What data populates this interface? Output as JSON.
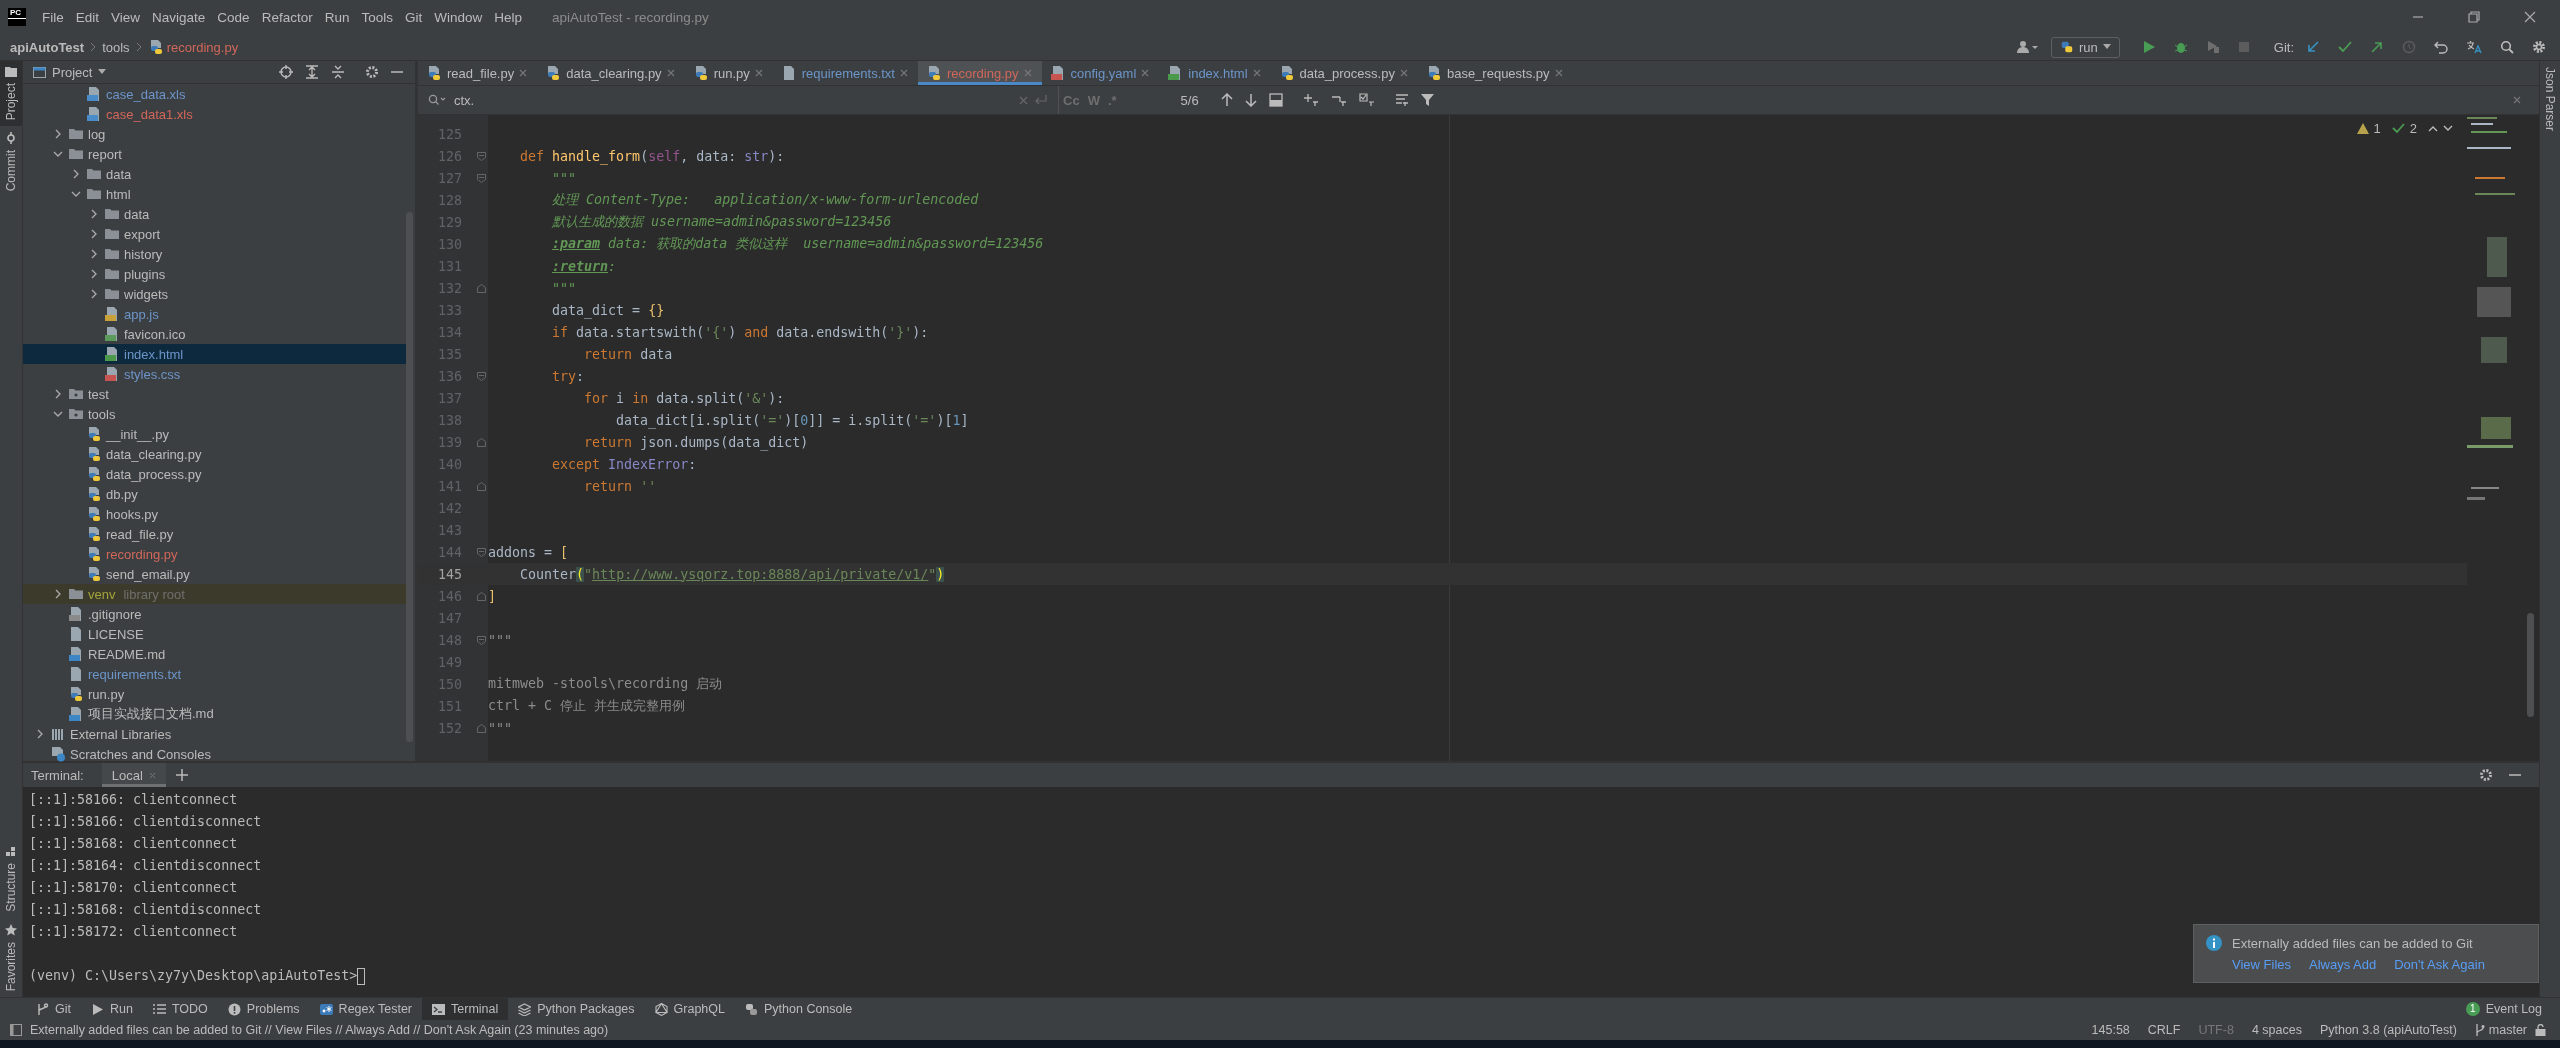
{
  "window": {
    "title": "apiAutoTest - recording.py",
    "logo": "PC"
  },
  "menu": [
    "File",
    "Edit",
    "View",
    "Navigate",
    "Code",
    "Refactor",
    "Run",
    "Tools",
    "Git",
    "Window",
    "Help"
  ],
  "breadcrumb": [
    {
      "label": "apiAutoTest",
      "kind": "project",
      "color": "#bbbbbb"
    },
    {
      "label": "tools",
      "kind": "folder",
      "color": "#bbbbbb"
    },
    {
      "label": "recording.py",
      "kind": "py",
      "color": "#d1675a"
    }
  ],
  "run_toolbar": {
    "configuration": "run",
    "git_label": "Git:"
  },
  "left_strip": {
    "top": [
      {
        "label": "Project",
        "selected": true,
        "kind": "project"
      },
      {
        "label": "Commit",
        "selected": false,
        "kind": "commit"
      }
    ],
    "bottom": [
      {
        "label": "Structure",
        "kind": "structure"
      },
      {
        "label": "Favorites",
        "kind": "favorites"
      }
    ]
  },
  "right_strip": {
    "label": "Json Parser"
  },
  "project_panel": {
    "title": "Project",
    "tree": [
      {
        "children": [
          {
            "children": [
              {
                "label": "case_data.xls",
                "kind": "xls",
                "color": "#6c95c9",
                "selected": false
              },
              {
                "label": "case_data1.xls",
                "kind": "xls",
                "color": "#d1675a",
                "selected": false
              }
            ]
          },
          {
            "label": "log",
            "kind": "folder",
            "expanded": false,
            "color": "#bbbbbb",
            "selected": false
          },
          {
            "label": "report",
            "kind": "folder",
            "expanded": true,
            "color": "#bbbbbb",
            "selected": false,
            "children": [
              {
                "label": "data",
                "kind": "folder",
                "expanded": false,
                "color": "#bbbbbb",
                "selected": false
              },
              {
                "label": "html",
                "kind": "folder",
                "expanded": true,
                "color": "#bbbbbb",
                "selected": false,
                "children": [
                  {
                    "label": "data",
                    "kind": "folder",
                    "expanded": false,
                    "color": "#bbbbbb",
                    "selected": false
                  },
                  {
                    "label": "export",
                    "kind": "folder",
                    "expanded": false,
                    "color": "#bbbbbb",
                    "selected": false
                  },
                  {
                    "label": "history",
                    "kind": "folder",
                    "expanded": false,
                    "color": "#bbbbbb",
                    "selected": false
                  },
                  {
                    "label": "plugins",
                    "kind": "folder",
                    "expanded": false,
                    "color": "#bbbbbb",
                    "selected": false
                  },
                  {
                    "label": "widgets",
                    "kind": "folder",
                    "expanded": false,
                    "color": "#bbbbbb",
                    "selected": false
                  },
                  {
                    "label": "app.js",
                    "kind": "js",
                    "color": "#6c95c9",
                    "selected": false
                  },
                  {
                    "label": "favicon.ico",
                    "kind": "ico",
                    "color": "#bbbbbb",
                    "selected": false
                  },
                  {
                    "label": "index.html",
                    "kind": "html",
                    "color": "#6c95c9",
                    "selected": true
                  },
                  {
                    "label": "styles.css",
                    "kind": "css",
                    "color": "#6c95c9",
                    "selected": false
                  }
                ]
              }
            ]
          },
          {
            "label": "test",
            "kind": "package",
            "expanded": false,
            "color": "#bbbbbb",
            "selected": false
          },
          {
            "label": "tools",
            "kind": "package",
            "expanded": true,
            "color": "#bbbbbb",
            "selected": false,
            "children": [
              {
                "label": "__init__.py",
                "kind": "py",
                "color": "#bbbbbb",
                "selected": false
              },
              {
                "label": "data_clearing.py",
                "kind": "py",
                "color": "#bbbbbb",
                "selected": false
              },
              {
                "label": "data_process.py",
                "kind": "py",
                "color": "#bbbbbb",
                "selected": false
              },
              {
                "label": "db.py",
                "kind": "py",
                "color": "#bbbbbb",
                "selected": false
              },
              {
                "label": "hooks.py",
                "kind": "py",
                "color": "#bbbbbb",
                "selected": false
              },
              {
                "label": "read_file.py",
                "kind": "py",
                "color": "#bbbbbb",
                "selected": false
              },
              {
                "label": "recording.py",
                "kind": "py",
                "color": "#d1675a",
                "selected": false
              },
              {
                "label": "send_email.py",
                "kind": "py",
                "color": "#bbbbbb",
                "selected": false
              }
            ]
          },
          {
            "label": "venv",
            "kind": "folder",
            "expanded": false,
            "color": "#a3a33b",
            "note": "library root",
            "selected": false
          },
          {
            "label": ".gitignore",
            "kind": "ignore",
            "color": "#bbbbbb",
            "selected": false
          },
          {
            "label": "LICENSE",
            "kind": "text",
            "color": "#bbbbbb",
            "selected": false
          },
          {
            "label": "README.md",
            "kind": "md",
            "color": "#bbbbbb",
            "selected": false
          },
          {
            "label": "requirements.txt",
            "kind": "text",
            "color": "#6c95c9",
            "selected": false
          },
          {
            "label": "run.py",
            "kind": "py",
            "color": "#bbbbbb",
            "selected": false
          },
          {
            "label": "项目实战接口文档.md",
            "kind": "md",
            "color": "#bbbbbb",
            "selected": false
          }
        ]
      },
      {
        "label": "External Libraries",
        "kind": "libraries",
        "expanded": false,
        "color": "#bbbbbb",
        "selected": false
      },
      {
        "label": "Scratches and Consoles",
        "kind": "scratches",
        "color": "#bbbbbb",
        "selected": false
      }
    ]
  },
  "editor": {
    "tabs": [
      {
        "label": "read_file.py",
        "kind": "py",
        "color": "#bbbbbb",
        "selected": false
      },
      {
        "label": "data_clearing.py",
        "kind": "py",
        "color": "#bbbbbb",
        "selected": false
      },
      {
        "label": "run.py",
        "kind": "py",
        "color": "#bbbbbb",
        "selected": false
      },
      {
        "label": "requirements.txt",
        "kind": "text",
        "color": "#6c95c9",
        "selected": false
      },
      {
        "label": "recording.py",
        "kind": "py",
        "color": "#d1675a",
        "selected": true
      },
      {
        "label": "config.yaml",
        "kind": "yaml",
        "color": "#6c95c9",
        "selected": false
      },
      {
        "label": "index.html",
        "kind": "html",
        "color": "#6c95c9",
        "selected": false
      },
      {
        "label": "data_process.py",
        "kind": "py",
        "color": "#bbbbbb",
        "selected": false
      },
      {
        "label": "base_requests.py",
        "kind": "py",
        "color": "#bbbbbb",
        "selected": false
      }
    ],
    "find": {
      "value": "ctx.",
      "options": [
        "Cc",
        "W",
        ".*"
      ],
      "match_count": "5/6"
    },
    "inspections": {
      "warnings": "1",
      "weak_warnings": "2"
    },
    "lines": [
      {
        "number": "125",
        "current": false,
        "kind": "plain"
      },
      {
        "number": "126",
        "current": false,
        "kind": "start",
        "tokens": [
          {
            "text": "    def ",
            "kind": "kw"
          },
          {
            "text": "handle_form",
            "kind": "fn"
          },
          {
            "text": "(",
            "kind": "plain"
          },
          {
            "text": "self",
            "kind": "self"
          },
          {
            "text": ", data: ",
            "kind": "plain"
          },
          {
            "text": "str",
            "kind": "builtin"
          },
          {
            "text": "):",
            "kind": "plain"
          }
        ]
      },
      {
        "number": "127",
        "current": false,
        "kind": "start",
        "tokens": [
          {
            "text": "        \"\"\"",
            "kind": "doc"
          }
        ]
      },
      {
        "number": "128",
        "current": false,
        "kind": "plain",
        "tokens": [
          {
            "text": "        处理 Content-Type:   application/x-www-form-urlencoded",
            "kind": "doc"
          }
        ]
      },
      {
        "number": "129",
        "current": false,
        "kind": "plain",
        "tokens": [
          {
            "text": "        默认生成的数据 username=admin&password=123456",
            "kind": "doc"
          }
        ]
      },
      {
        "number": "130",
        "current": false,
        "kind": "plain",
        "tokens": [
          {
            "text": "        :param",
            "kind": "doctag"
          },
          {
            "text": " data: 获取的data 类似这样  username=admin&password=123456",
            "kind": "doc"
          }
        ]
      },
      {
        "number": "131",
        "current": false,
        "kind": "plain",
        "tokens": [
          {
            "text": "        :return",
            "kind": "doctag"
          },
          {
            "text": ":",
            "kind": "doc"
          }
        ]
      },
      {
        "number": "132",
        "current": false,
        "kind": "end",
        "tokens": [
          {
            "text": "        \"\"\"",
            "kind": "doc"
          }
        ]
      },
      {
        "number": "133",
        "current": false,
        "kind": "plain",
        "tokens": [
          {
            "text": "        data_dict = ",
            "kind": "plain"
          },
          {
            "text": "{}",
            "kind": "brace"
          }
        ]
      },
      {
        "number": "134",
        "current": false,
        "kind": "plain",
        "tokens": [
          {
            "text": "        if ",
            "kind": "kw"
          },
          {
            "text": "data.startswith(",
            "kind": "plain"
          },
          {
            "text": "'{'",
            "kind": "str"
          },
          {
            "text": ") ",
            "kind": "plain"
          },
          {
            "text": "and ",
            "kind": "kw"
          },
          {
            "text": "data.endswith(",
            "kind": "plain"
          },
          {
            "text": "'}'",
            "kind": "str"
          },
          {
            "text": "):",
            "kind": "plain"
          }
        ]
      },
      {
        "number": "135",
        "current": false,
        "kind": "plain",
        "tokens": [
          {
            "text": "            return ",
            "kind": "kw"
          },
          {
            "text": "data",
            "kind": "plain"
          }
        ]
      },
      {
        "number": "136",
        "current": false,
        "kind": "start",
        "tokens": [
          {
            "text": "        try",
            "kind": "kw"
          },
          {
            "text": ":",
            "kind": "plain"
          }
        ]
      },
      {
        "number": "137",
        "current": false,
        "kind": "plain",
        "tokens": [
          {
            "text": "            for ",
            "kind": "kw"
          },
          {
            "text": "i ",
            "kind": "plain"
          },
          {
            "text": "in ",
            "kind": "kw"
          },
          {
            "text": "data.split(",
            "kind": "plain"
          },
          {
            "text": "'&'",
            "kind": "str"
          },
          {
            "text": "):",
            "kind": "plain"
          }
        ]
      },
      {
        "number": "138",
        "current": false,
        "kind": "plain",
        "tokens": [
          {
            "text": "                data_dict[i.split(",
            "kind": "plain"
          },
          {
            "text": "'='",
            "kind": "str"
          },
          {
            "text": ")[",
            "kind": "plain"
          },
          {
            "text": "0",
            "kind": "num"
          },
          {
            "text": "]] = i.split(",
            "kind": "plain"
          },
          {
            "text": "'='",
            "kind": "str"
          },
          {
            "text": ")[",
            "kind": "plain"
          },
          {
            "text": "1",
            "kind": "num"
          },
          {
            "text": "]",
            "kind": "plain"
          }
        ]
      },
      {
        "number": "139",
        "current": false,
        "kind": "end",
        "tokens": [
          {
            "text": "            return ",
            "kind": "kw"
          },
          {
            "text": "json.dumps(data_dict)",
            "kind": "plain"
          }
        ]
      },
      {
        "number": "140",
        "current": false,
        "kind": "plain",
        "tokens": [
          {
            "text": "        except ",
            "kind": "kw"
          },
          {
            "text": "IndexError",
            "kind": "builtin"
          },
          {
            "text": ":",
            "kind": "plain"
          }
        ]
      },
      {
        "number": "141",
        "current": false,
        "kind": "end",
        "tokens": [
          {
            "text": "            return ",
            "kind": "kw"
          },
          {
            "text": "''",
            "kind": "str"
          }
        ]
      },
      {
        "number": "142",
        "current": false,
        "kind": "plain"
      },
      {
        "number": "143",
        "current": false,
        "kind": "plain"
      },
      {
        "number": "144",
        "current": false,
        "kind": "start",
        "tokens": [
          {
            "text": "addons = ",
            "kind": "plain"
          },
          {
            "text": "[",
            "kind": "brace"
          }
        ]
      },
      {
        "number": "145",
        "current": true,
        "kind": "plain",
        "tokens": [
          {
            "text": "    Counter",
            "kind": "plain"
          },
          {
            "text": "(",
            "kind": "match"
          },
          {
            "text": "\"",
            "kind": "str"
          },
          {
            "text": "http://www.ysqorz.top:8888/api/private/v1/",
            "kind": "link"
          },
          {
            "text": "\"",
            "kind": "str"
          },
          {
            "text": ")",
            "kind": "match"
          }
        ]
      },
      {
        "number": "146",
        "current": false,
        "kind": "end",
        "tokens": [
          {
            "text": "]",
            "kind": "brace"
          }
        ]
      },
      {
        "number": "147",
        "current": false,
        "kind": "plain"
      },
      {
        "number": "148",
        "current": false,
        "kind": "start",
        "tokens": [
          {
            "text": "\"\"\"",
            "kind": "block"
          }
        ]
      },
      {
        "number": "149",
        "current": false,
        "kind": "plain"
      },
      {
        "number": "150",
        "current": false,
        "kind": "plain",
        "tokens": [
          {
            "text": "mitmweb -stools\\recording 启动",
            "kind": "block"
          }
        ]
      },
      {
        "number": "151",
        "current": false,
        "kind": "plain",
        "tokens": [
          {
            "text": "ctrl + C 停止 并生成完整用例",
            "kind": "block"
          }
        ]
      },
      {
        "number": "152",
        "current": false,
        "kind": "end",
        "tokens": [
          {
            "text": "\"\"\"",
            "kind": "block"
          }
        ]
      }
    ]
  },
  "terminal": {
    "title": "Terminal:",
    "tabs": [
      {
        "label": "Local",
        "selected": true
      }
    ],
    "lines": [
      "[::1]:58166: clientconnect",
      "[::1]:58166: clientdisconnect",
      "[::1]:58168: clientconnect",
      "[::1]:58164: clientdisconnect",
      "[::1]:58170: clientconnect",
      "[::1]:58168: clientdisconnect",
      "[::1]:58172: clientconnect"
    ],
    "prompt": "(venv) C:\\Users\\zy7y\\Desktop\\apiAutoTest>"
  },
  "notification": {
    "message": "Externally added files can be added to Git",
    "actions": [
      "View Files",
      "Always Add",
      "Don't Ask Again"
    ]
  },
  "tool_windows": [
    {
      "label": "Git",
      "kind": "git",
      "selected": false
    },
    {
      "label": "Run",
      "kind": "run",
      "selected": false
    },
    {
      "label": "TODO",
      "kind": "todo",
      "selected": false
    },
    {
      "label": "Problems",
      "kind": "problems",
      "selected": false
    },
    {
      "label": "Regex Tester",
      "kind": "regex",
      "selected": false
    },
    {
      "label": "Terminal",
      "kind": "terminal",
      "selected": true
    },
    {
      "label": "Python Packages",
      "kind": "packages",
      "selected": false
    },
    {
      "label": "GraphQL",
      "kind": "graphql",
      "selected": false
    },
    {
      "label": "Python Console",
      "kind": "python",
      "selected": false
    }
  ],
  "event_log": {
    "label": "Event Log",
    "count": "1"
  },
  "status_bar": {
    "message": "Externally added files can be added to Git // View Files // Always Add // Don't Ask Again (23 minutes ago)",
    "items": [
      {
        "text": "145:58",
        "disabled": false
      },
      {
        "text": "CRLF",
        "disabled": false
      },
      {
        "text": "UTF-8",
        "disabled": true
      },
      {
        "text": "4 spaces",
        "disabled": false
      },
      {
        "text": "Python 3.8 (apiAutoTest)",
        "disabled": false
      },
      {
        "text": "master",
        "kind": "branch",
        "disabled": false
      }
    ]
  }
}
